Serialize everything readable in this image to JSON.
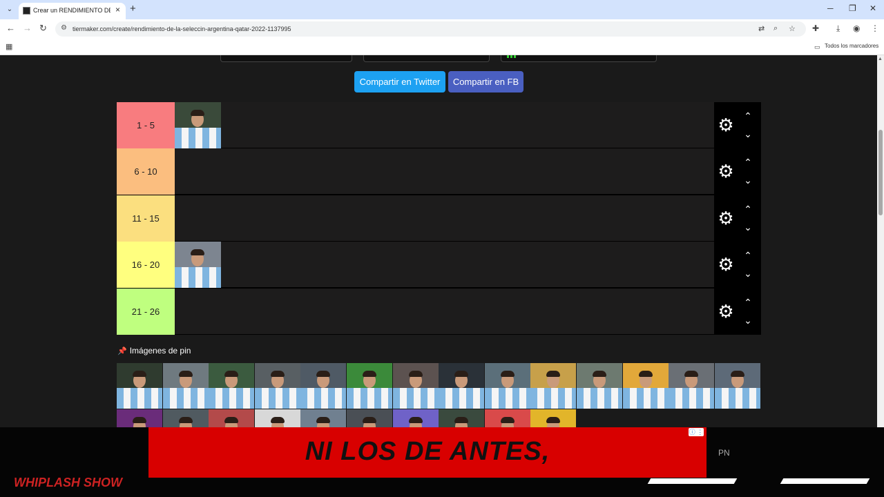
{
  "browser": {
    "tab_title": "Crear un RENDIMIENTO DE LA",
    "tab_close": "×",
    "new_tab": "+",
    "url": "tiermaker.com/create/rendimiento-de-la-seleccin-argentina-qatar-2022-1137995",
    "bookmarks_label": "Todos los marcadores",
    "icons": {
      "tab_list": "⌄",
      "back": "←",
      "forward": "→",
      "reload": "↻",
      "site_info": "⚙",
      "translate": "⇄",
      "zoom": "⌕",
      "star": "☆",
      "extensions": "✚",
      "download": "⤓",
      "profile": "◉",
      "menu": "⋮",
      "apps": "▦",
      "folder": "▭",
      "minimize": "─",
      "maximize": "❐",
      "close": "✕"
    }
  },
  "share": {
    "twitter_label": "Compartir en Twitter",
    "fb_label": "Compartir en FB"
  },
  "tiers": [
    {
      "label": "1 - 5",
      "color": "#f87c7f",
      "players": 1
    },
    {
      "label": "6 - 10",
      "color": "#fbbe7f",
      "players": 0
    },
    {
      "label": "11 - 15",
      "color": "#fbdf7f",
      "players": 0
    },
    {
      "label": "16 - 20",
      "color": "#ffff7f",
      "players": 1
    },
    {
      "label": "21 - 26",
      "color": "#bfff7f",
      "players": 0
    }
  ],
  "tier_controls": {
    "gear": "⚙",
    "up": "⌃",
    "down": "⌄"
  },
  "pin_section": {
    "title": "Imágenes de pin",
    "icon": "📌"
  },
  "ad": {
    "text": "NI LOS DE ANTES,",
    "info": "ⓘ ⋮",
    "side_label": "PN",
    "bottom_text": "WHIPLASH SHOW"
  }
}
